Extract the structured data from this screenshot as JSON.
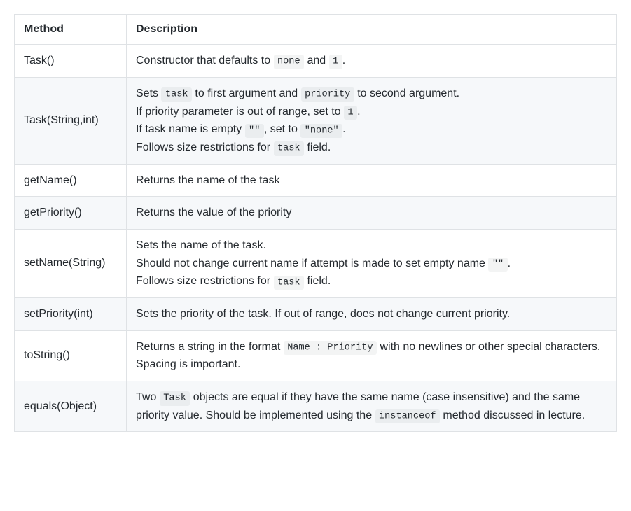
{
  "table": {
    "headers": {
      "method": "Method",
      "description": "Description"
    },
    "rows": [
      {
        "method": "Task()",
        "desc": {
          "t0": "Constructor that defaults to ",
          "c0": "none",
          "t1": " and ",
          "c1": "1",
          "t2": "."
        }
      },
      {
        "method": "Task(String,int)",
        "desc": {
          "l0t0": "Sets ",
          "l0c0": "task",
          "l0t1": " to first argument and ",
          "l0c1": "priority",
          "l0t2": " to second argument.",
          "l1t0": "If priority parameter is out of range, set to ",
          "l1c0": "1",
          "l1t1": ".",
          "l2t0": "If task name is empty ",
          "l2c0": "\"\"",
          "l2t1": ", set to ",
          "l2c1": "\"none\"",
          "l2t2": ".",
          "l3t0": "Follows size restrictions for ",
          "l3c0": "task",
          "l3t1": " field."
        }
      },
      {
        "method": "getName()",
        "desc": {
          "t0": "Returns the name of the task"
        }
      },
      {
        "method": "getPriority()",
        "desc": {
          "t0": "Returns the value of the priority"
        }
      },
      {
        "method": "setName(String)",
        "desc": {
          "l0t0": "Sets the name of the task.",
          "l1t0": "Should not change current name if attempt is made to set empty name ",
          "l1c0": "\"\"",
          "l1t1": ".",
          "l2t0": "Follows size restrictions for ",
          "l2c0": "task",
          "l2t1": " field."
        }
      },
      {
        "method": "setPriority(int)",
        "desc": {
          "t0": "Sets the priority of the task. If out of range, does not change current priority."
        }
      },
      {
        "method": "toString()",
        "desc": {
          "t0": "Returns a string in the format ",
          "c0": "Name : Priority",
          "t1": " with no newlines or other special characters. Spacing is important."
        }
      },
      {
        "method": "equals(Object)",
        "desc": {
          "t0": "Two ",
          "c0": "Task",
          "t1": " objects are equal if they have the same name (case insensitive) and the same priority value. Should be implemented using the ",
          "c1": "instanceof",
          "t2": " method discussed in lecture."
        }
      }
    ]
  }
}
